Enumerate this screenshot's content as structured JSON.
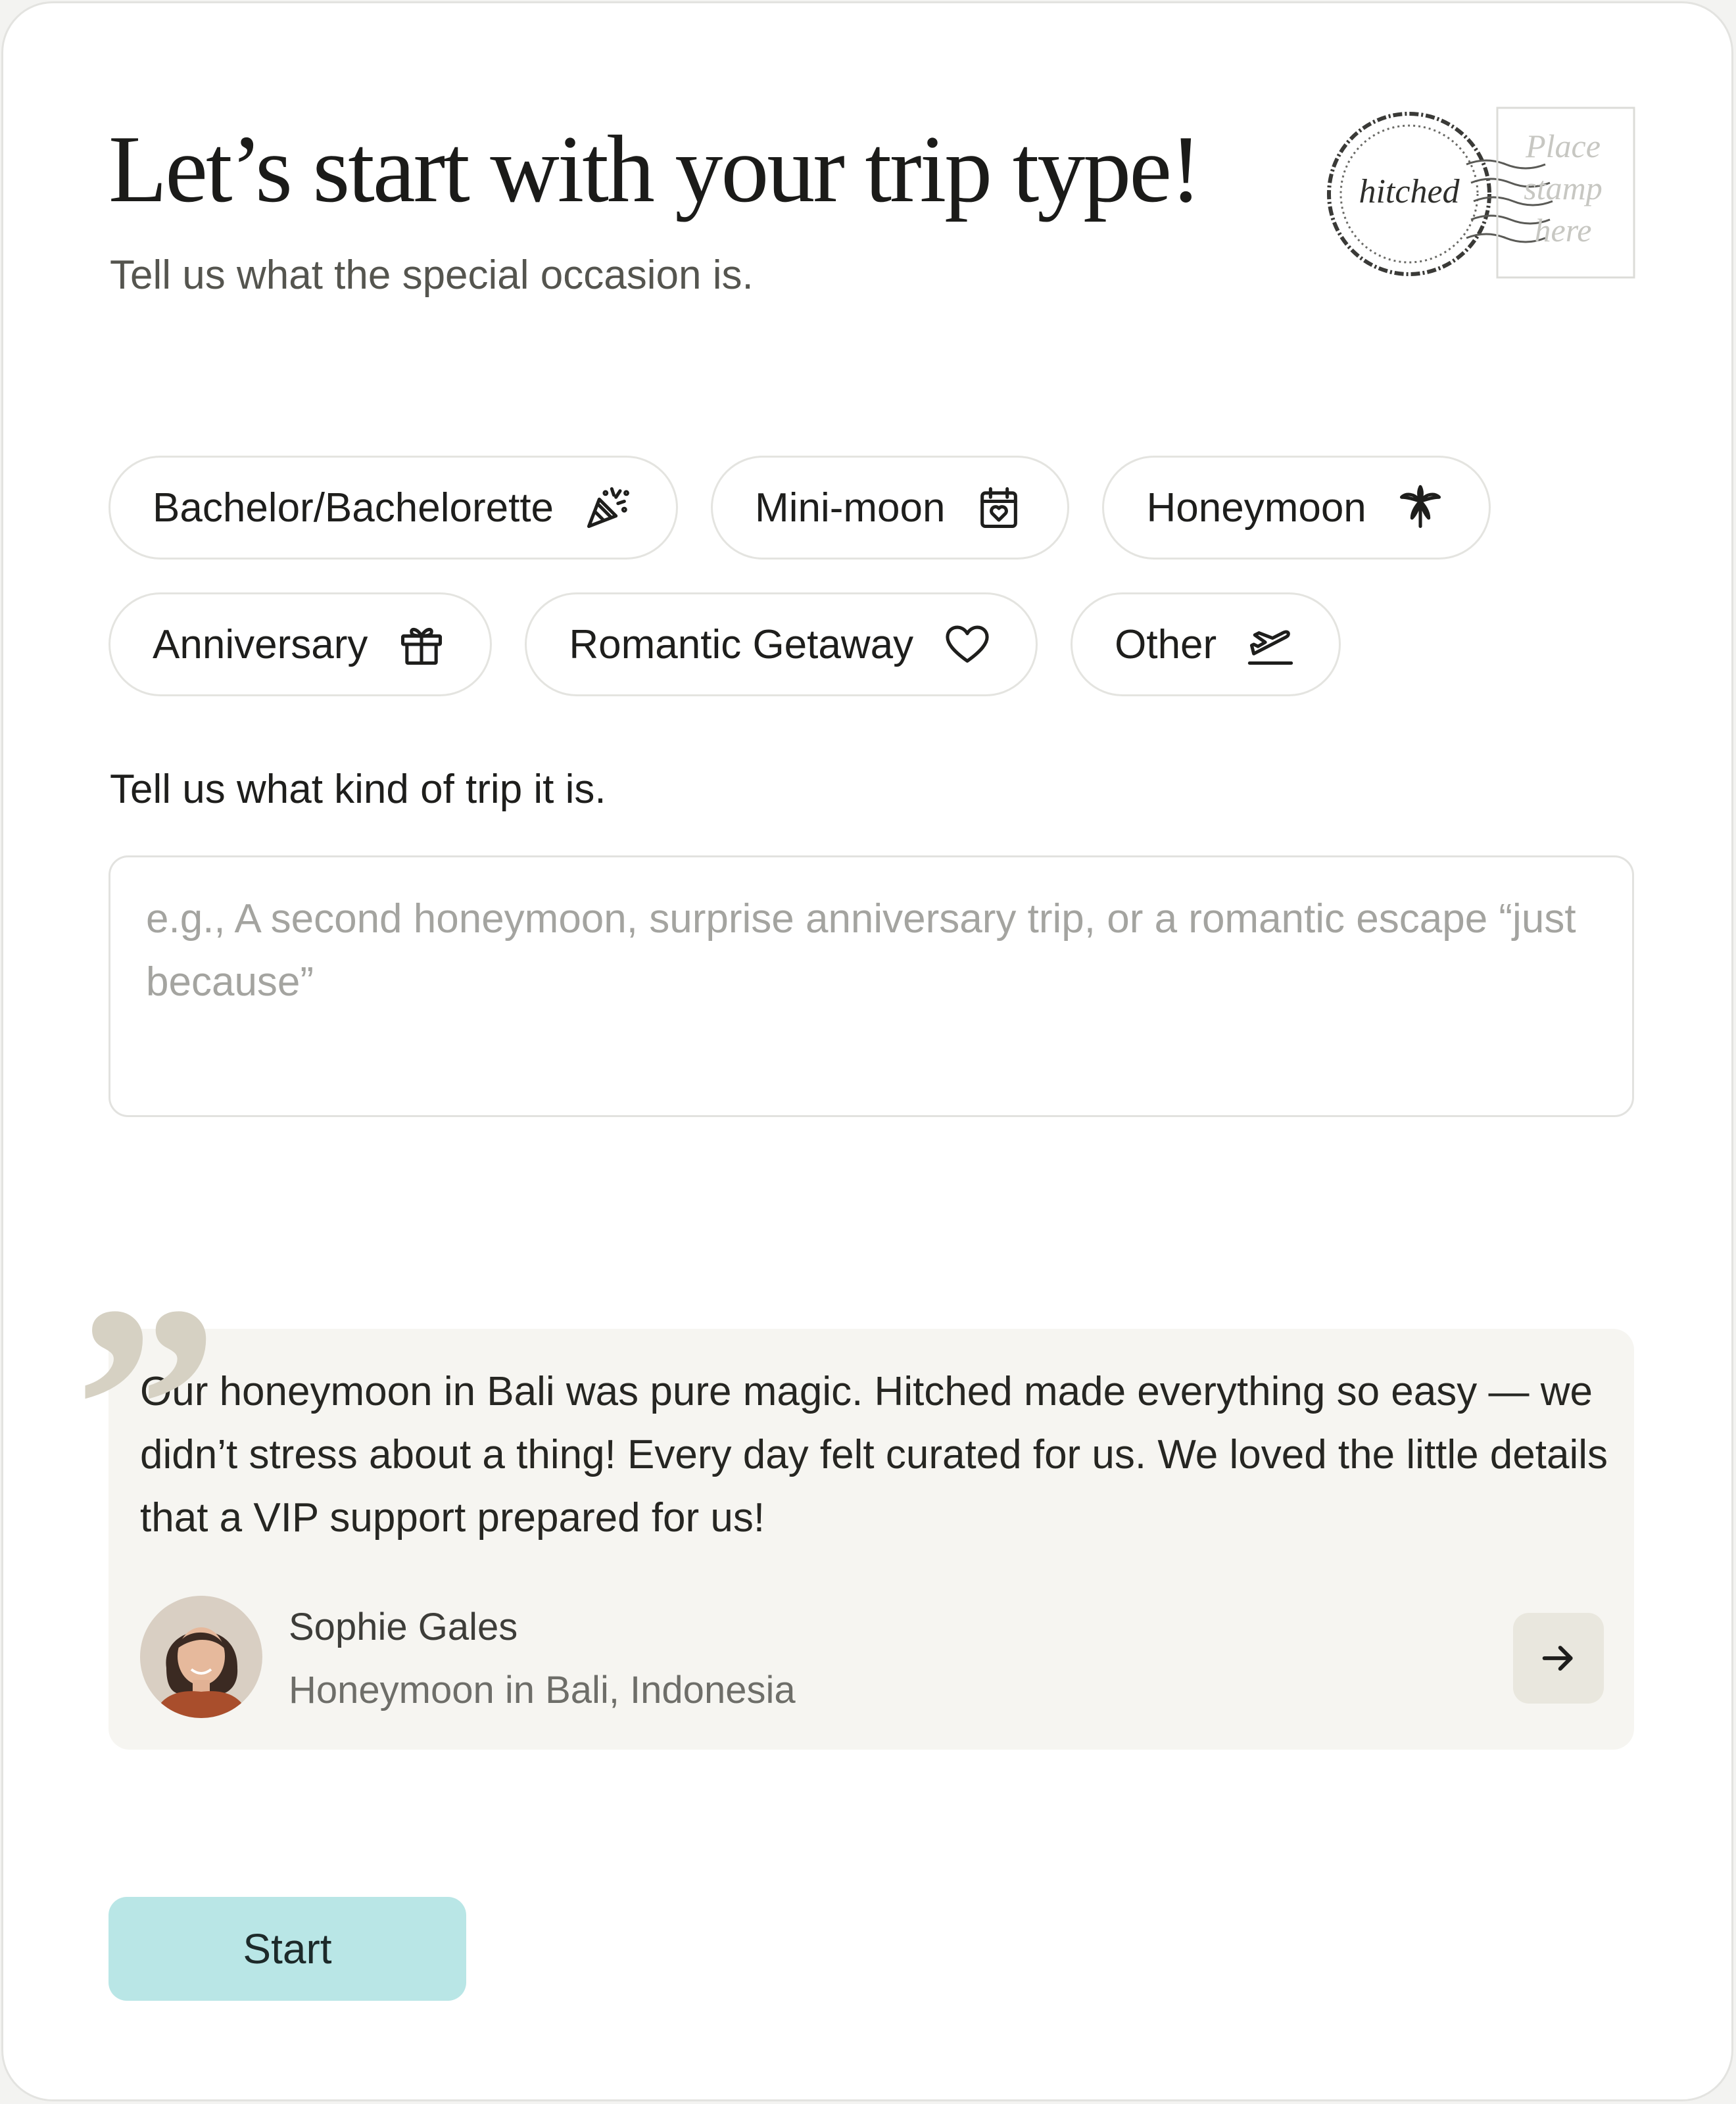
{
  "header": {
    "title": "Let’s start with your trip type!",
    "subtitle": "Tell us what the special occasion is."
  },
  "stamp": {
    "logo_text": "hitched",
    "caption_line1": "Place",
    "caption_line2": "stamp",
    "caption_line3": "here"
  },
  "trip_types": [
    {
      "label": "Bachelor/Bachelorette",
      "icon": "party-popper-icon"
    },
    {
      "label": "Mini-moon",
      "icon": "calendar-heart-icon"
    },
    {
      "label": "Honeymoon",
      "icon": "palm-tree-icon"
    },
    {
      "label": "Anniversary",
      "icon": "gift-icon"
    },
    {
      "label": "Romantic Getaway",
      "icon": "heart-icon"
    },
    {
      "label": "Other",
      "icon": "plane-takeoff-icon"
    }
  ],
  "trip_description": {
    "label": "Tell us what kind of trip it is.",
    "placeholder": "e.g., A second honeymoon, surprise anniversary trip, or a romantic escape “just because”"
  },
  "testimonial": {
    "quote": "Our honeymoon in Bali was pure magic. Hitched made everything so easy — we didn’t stress about a thing! Every day felt curated for us. We loved the little details that a VIP support prepared for us!",
    "author_name": "Sophie Gales",
    "author_trip": "Honeymoon in Bali, Indonesia",
    "next_icon": "arrow-right-icon"
  },
  "actions": {
    "start_label": "Start"
  },
  "colors": {
    "background": "#ffffff",
    "chip_border": "#e4e4e0",
    "testimonial_bg": "#f6f5f1",
    "quote_mark": "#d6d1c3",
    "start_button": "#b9e6e6"
  }
}
